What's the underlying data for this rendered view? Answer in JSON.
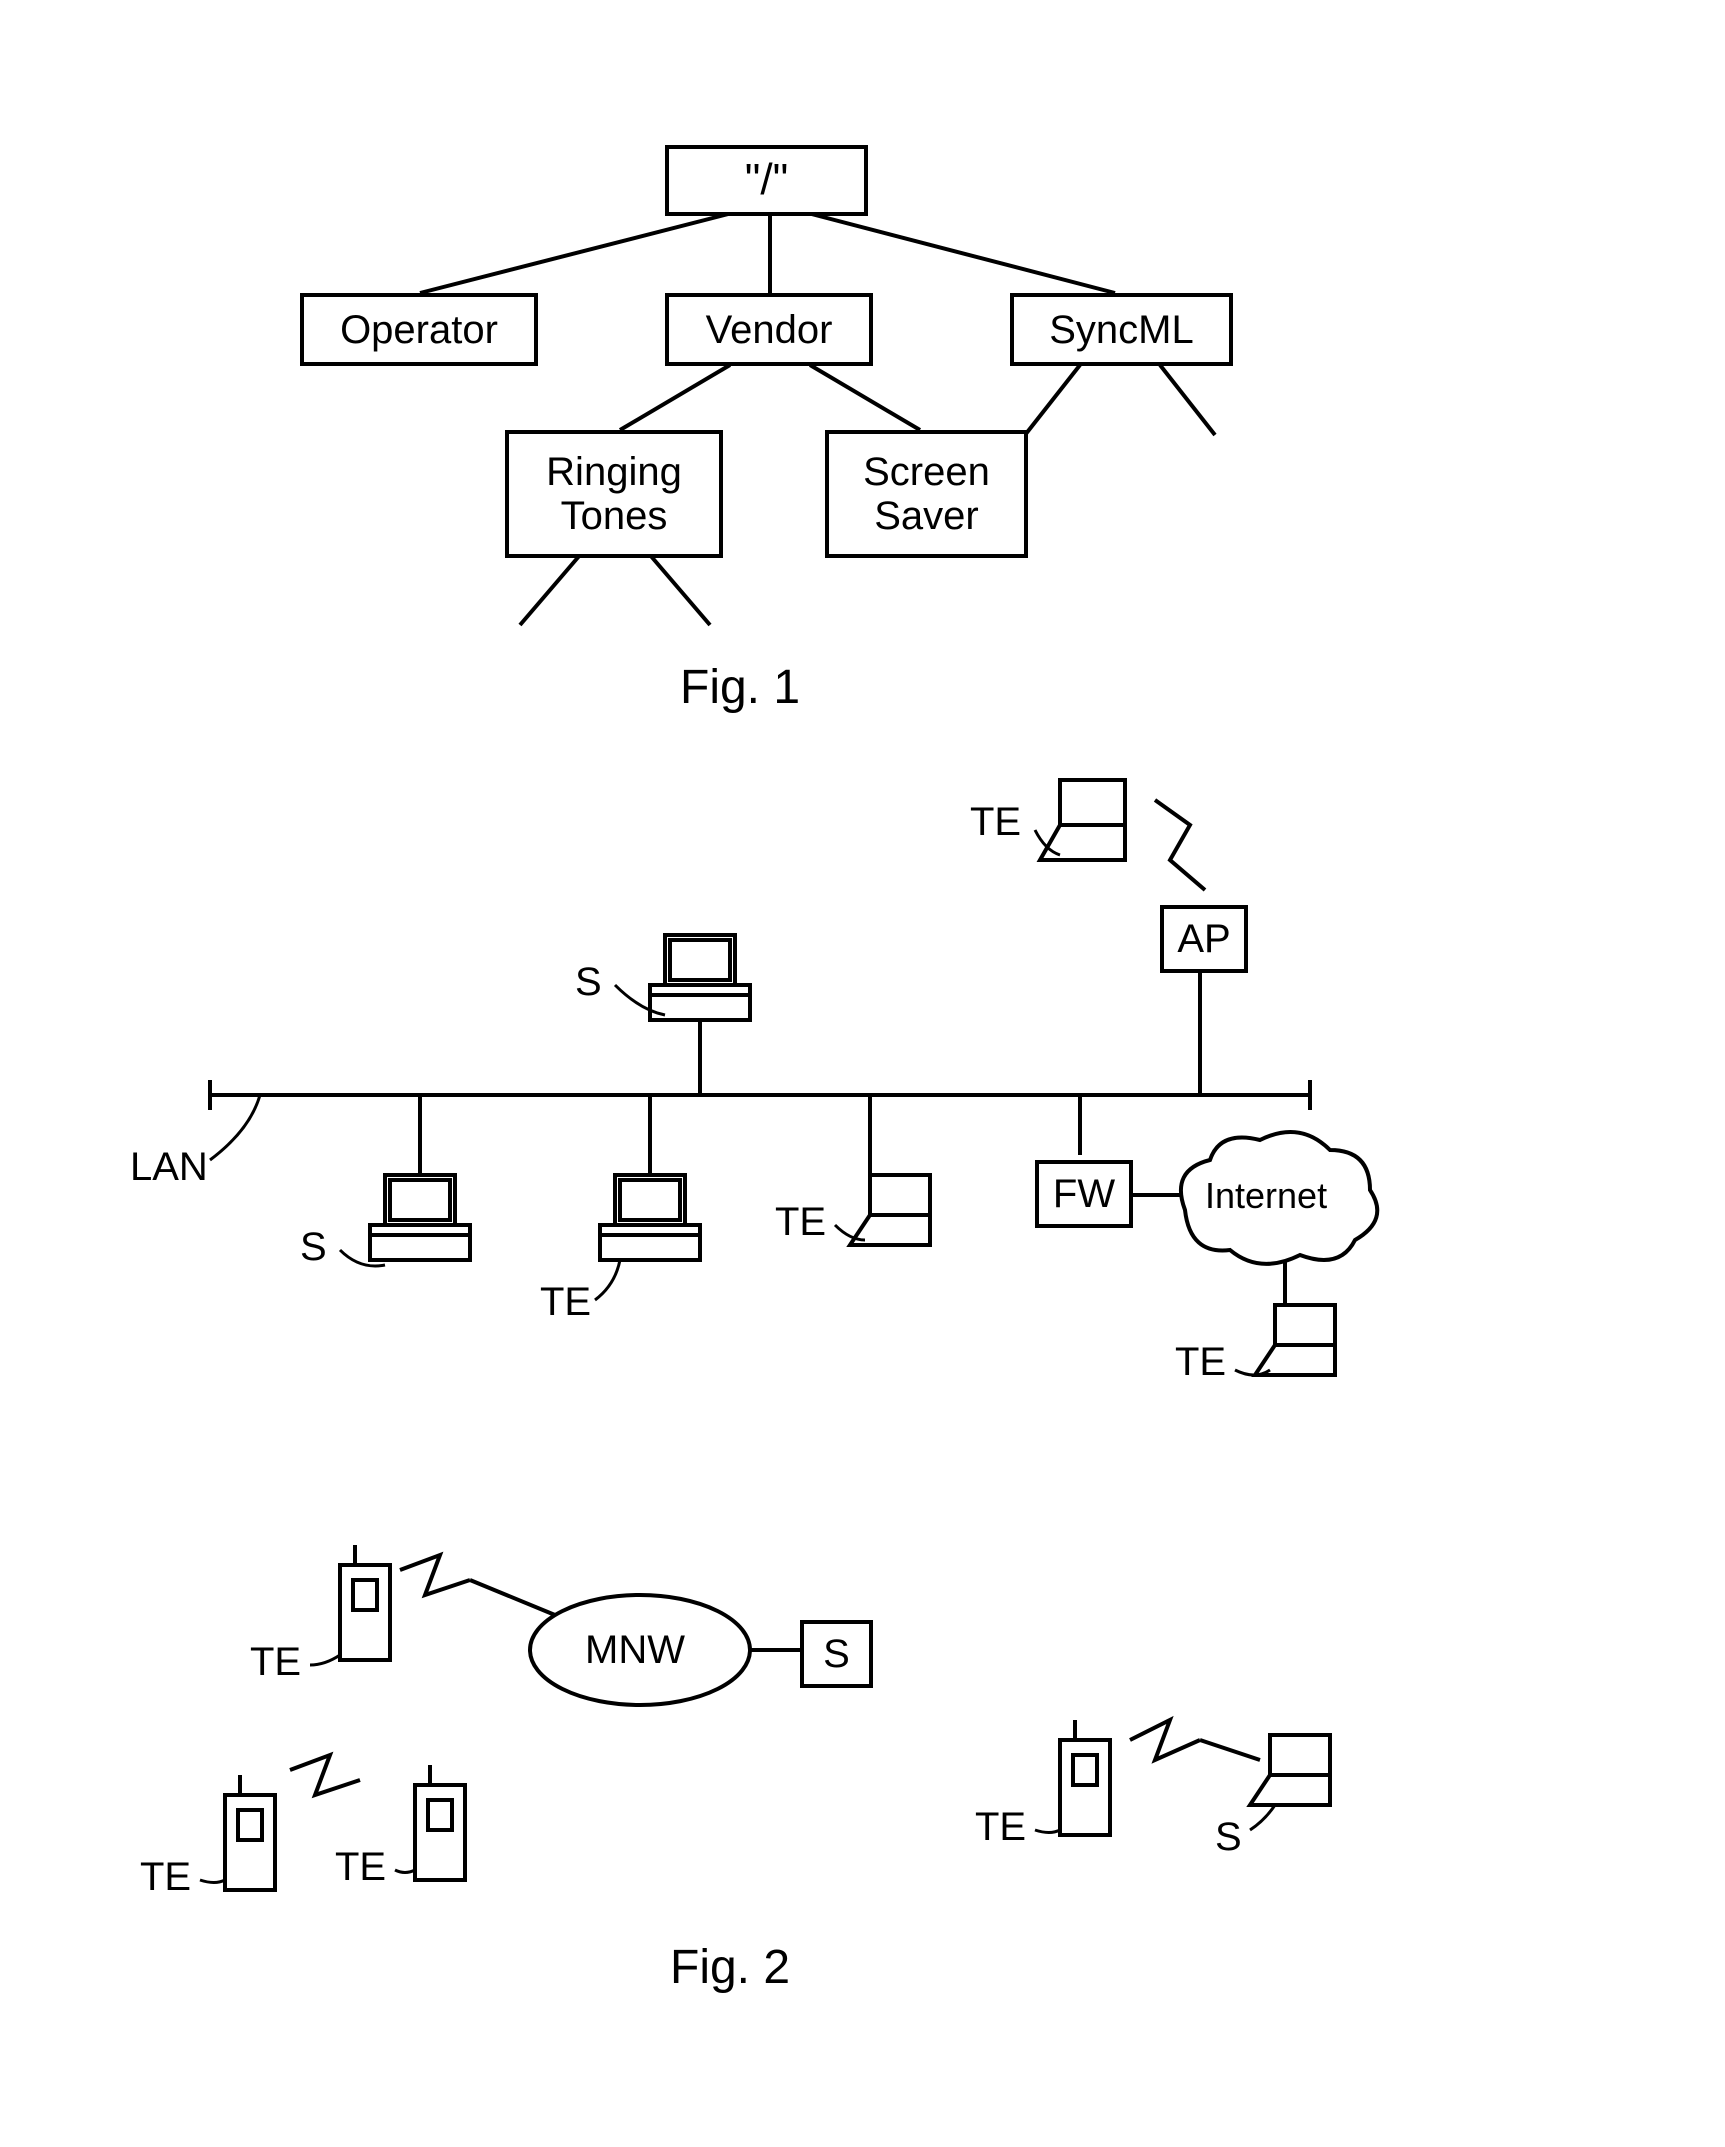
{
  "fig1": {
    "caption": "Fig. 1",
    "tree": {
      "root": "\"/\"",
      "level1": {
        "operator": "Operator",
        "vendor": "Vendor",
        "syncml": "SyncML"
      },
      "level2": {
        "ringing_tones": "Ringing\nTones",
        "screen_saver": "Screen\nSaver"
      }
    }
  },
  "fig2": {
    "caption": "Fig. 2",
    "labels": {
      "lan": "LAN",
      "te": "TE",
      "s": "S",
      "ap": "AP",
      "fw": "FW",
      "internet": "Internet",
      "mnw": "MNW"
    }
  }
}
